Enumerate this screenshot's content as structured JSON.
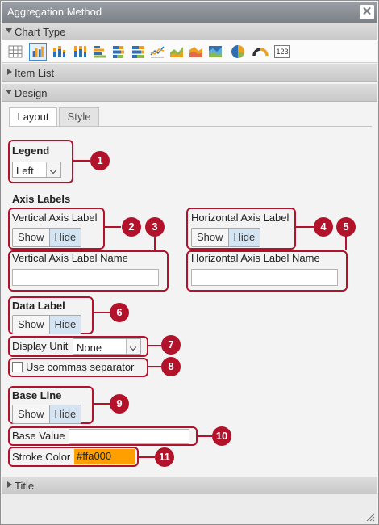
{
  "window": {
    "title": "Aggregation Method",
    "close_icon": "close-icon"
  },
  "sections": {
    "chart_type": "Chart Type",
    "item_list": "Item List",
    "design": "Design",
    "title": "Title"
  },
  "toolbar": {
    "icons": [
      "table-icon",
      "clustered-column-chart-icon",
      "stacked-column-chart-icon",
      "percent-column-chart-icon",
      "clustered-bar-chart-icon",
      "stacked-bar-chart-icon",
      "percent-bar-chart-icon",
      "line-chart-icon",
      "area-chart-icon",
      "stacked-area-chart-icon",
      "percent-area-chart-icon",
      "pie-chart-icon",
      "gauge-chart-icon",
      "number-card-icon"
    ],
    "selected": "clustered-column-chart-icon",
    "number_label": "123"
  },
  "tabs": {
    "layout": "Layout",
    "style": "Style",
    "active": "Layout"
  },
  "legend": {
    "label": "Legend",
    "value": "Left"
  },
  "axis_labels": {
    "heading": "Axis Labels",
    "vertical": {
      "label": "Vertical Axis Label",
      "show": "Show",
      "hide": "Hide",
      "selected": "Hide",
      "name_label": "Vertical Axis Label Name",
      "name_value": ""
    },
    "horizontal": {
      "label": "Horizontal Axis Label",
      "show": "Show",
      "hide": "Hide",
      "selected": "Hide",
      "name_label": "Horizontal Axis Label Name",
      "name_value": ""
    }
  },
  "data_label": {
    "label": "Data Label",
    "show": "Show",
    "hide": "Hide",
    "selected": "Hide"
  },
  "display_unit": {
    "label": "Display Unit",
    "value": "None"
  },
  "commas": {
    "label": "Use commas separator",
    "checked": false
  },
  "base_line": {
    "label": "Base Line",
    "show": "Show",
    "hide": "Hide",
    "selected": "Hide"
  },
  "base_value": {
    "label": "Base Value",
    "value": ""
  },
  "stroke_color": {
    "label": "Stroke Color",
    "value": "#ffa000"
  },
  "callouts": [
    "1",
    "2",
    "3",
    "4",
    "5",
    "6",
    "7",
    "8",
    "9",
    "10",
    "11"
  ],
  "colors": {
    "callout": "#b3122b",
    "accent": "#3a8bd0",
    "stroke": "#ffa000",
    "titlebar": "#8a9096"
  }
}
